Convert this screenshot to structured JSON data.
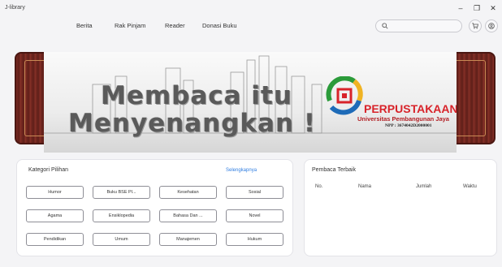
{
  "window": {
    "title": "J-library",
    "minimize_label": "–",
    "maximize_label": "❐",
    "close_label": "✕"
  },
  "nav": {
    "items": [
      {
        "label": "Berita"
      },
      {
        "label": "Rak Pinjam"
      },
      {
        "label": "Reader"
      },
      {
        "label": "Donasi Buku"
      }
    ]
  },
  "search": {
    "placeholder": "",
    "value": ""
  },
  "header_icons": [
    "search-icon",
    "cart-icon",
    "user-icon"
  ],
  "banner": {
    "line1": "Membaca itu",
    "line2": "Menyenangkan !",
    "library_name": "PERPUSTAKAAN",
    "library_sub": "Universitas Pembangunan Jaya",
    "library_npp": "NPP : 3674042D2000001"
  },
  "categories": {
    "title": "Kategori Pilihan",
    "see_all": "Selengkapnya",
    "items": [
      "Humor",
      "Buku BSE Pl...",
      "Kesehatan",
      "Sosial",
      "Agama",
      "Ensiklopedia",
      "Bahasa Dan ...",
      "Novel",
      "Pendidikan",
      "Umum",
      "Manajemen",
      "Hukum"
    ]
  },
  "top_readers": {
    "title": "Pembaca Terbaik",
    "columns": [
      "No.",
      "Nama",
      "Jumlah",
      "Waktu"
    ],
    "rows": []
  },
  "colors": {
    "accent_link": "#2f7de1",
    "banner_frame": "#7a2a22",
    "logo_red": "#d8232a"
  }
}
